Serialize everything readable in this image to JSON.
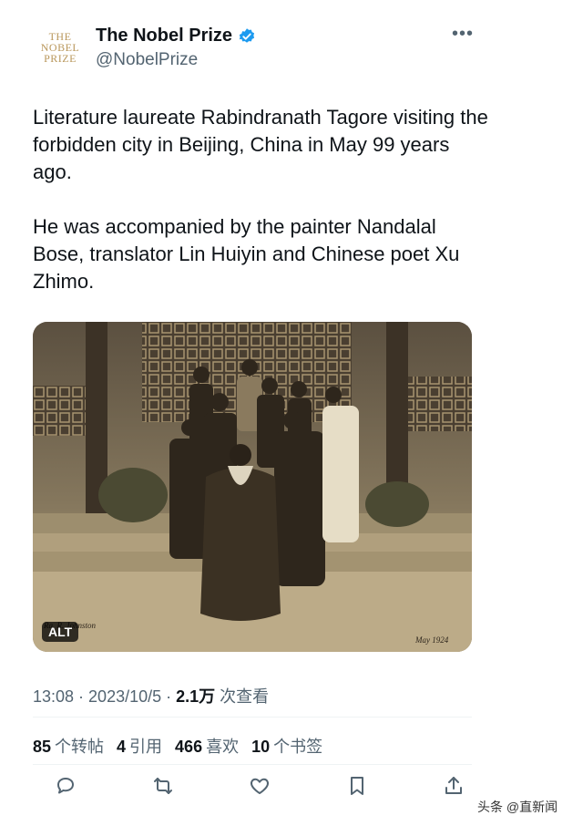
{
  "account": {
    "avatar_lines": [
      "THE",
      "NOBEL",
      "PRIZE"
    ],
    "display_name": "The Nobel Prize",
    "handle": "@NobelPrize",
    "verified_icon": "verified-badge-icon",
    "more_icon": "more-options-icon"
  },
  "tweet": {
    "text": "Literature laureate Rabindranath Tagore visiting the forbidden city in Beijing, China in May 99 years ago.\n\nHe was accompanied by the painter Nandalal Bose, translator Lin Huiyin and Chinese poet Xu Zhimo.",
    "alt_badge": "ALT"
  },
  "meta": {
    "time": "13:08",
    "dot": " · ",
    "date": "2023/10/5",
    "views_count": "2.1万",
    "views_label": " 次查看"
  },
  "stats": {
    "reposts_count": "85",
    "reposts_label": "个转帖",
    "quotes_count": "4",
    "quotes_label": "引用",
    "likes_count": "466",
    "likes_label": "喜欢",
    "bookmarks_count": "10",
    "bookmarks_label": "个书签"
  },
  "actions": [
    "reply-icon",
    "retweet-icon",
    "like-icon",
    "bookmark-icon",
    "share-icon"
  ],
  "watermark": "头条 @直新闻",
  "colors": {
    "text": "#0f1419",
    "secondary": "#536471",
    "verified": "#1d9bf0",
    "gold": "#b9975b"
  }
}
